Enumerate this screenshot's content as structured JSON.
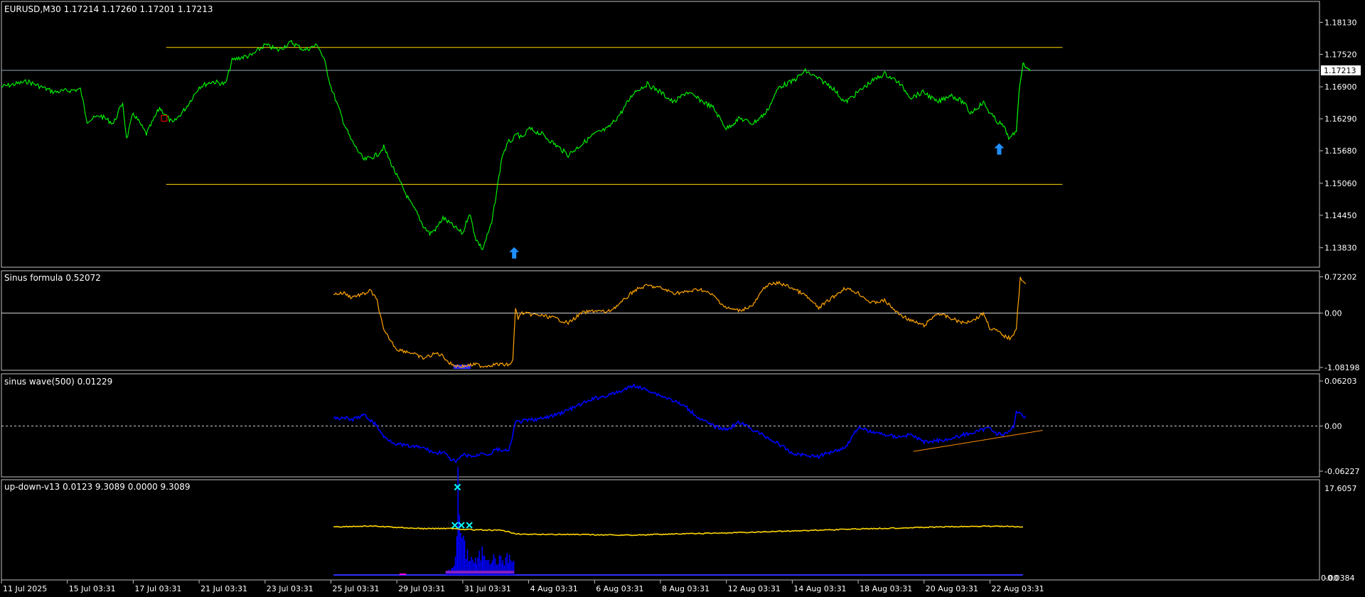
{
  "colors": {
    "background": "#000000",
    "frame": "#c0c0c0",
    "text": "#ffffff",
    "price_line": "#00ff00",
    "channel": "#ffd700",
    "current_price_line": "#8fa3b8",
    "sinus_formula": "#ffa500",
    "sinus_wave": "#0000ff",
    "trendline": "#ff8c00",
    "updown_line": "#ffd700",
    "updown_hist": "#0000ff",
    "arrow": "#1e90ff",
    "cross": "#00ffff"
  },
  "icons": {
    "buy_arrow": "up-arrow-icon",
    "signal_cross": "cross-icon",
    "pending_marker": "square-marker-icon"
  },
  "chart_data": [
    {
      "id": "main",
      "type": "line",
      "title": "EURUSD,M30  1.17214 1.17260 1.17201 1.17213",
      "ylim": [
        1.1354,
        1.1842
      ],
      "yticks": [
        "1.18130",
        "1.17520",
        "1.16900",
        "1.16290",
        "1.15680",
        "1.15060",
        "1.14450",
        "1.13830"
      ],
      "current_price": "1.17213",
      "channel": {
        "upper": 1.1765,
        "lower": 1.1504,
        "x_start": 0.125,
        "x_end": 0.805
      },
      "series": [
        {
          "x": [
            0.0,
            0.02,
            0.04,
            0.06,
            0.065,
            0.075,
            0.085,
            0.092,
            0.095,
            0.1,
            0.11,
            0.12,
            0.13,
            0.14,
            0.15,
            0.16,
            0.17,
            0.175,
            0.18,
            0.19,
            0.2,
            0.21,
            0.22,
            0.23,
            0.24,
            0.245,
            0.25,
            0.26,
            0.265,
            0.275,
            0.285,
            0.29,
            0.3,
            0.31,
            0.315,
            0.32,
            0.325,
            0.33,
            0.335,
            0.345,
            0.35,
            0.355,
            0.36,
            0.365,
            0.372,
            0.38,
            0.385,
            0.388,
            0.39,
            0.392,
            0.395,
            0.4,
            0.41,
            0.42,
            0.43,
            0.44,
            0.45,
            0.46,
            0.47,
            0.48,
            0.49,
            0.5,
            0.51,
            0.52,
            0.53,
            0.54,
            0.55,
            0.56,
            0.57,
            0.58,
            0.59,
            0.6,
            0.61,
            0.62,
            0.63,
            0.64,
            0.65,
            0.66,
            0.67,
            0.68,
            0.69,
            0.7,
            0.71,
            0.72,
            0.73,
            0.735,
            0.74,
            0.745,
            0.75,
            0.755,
            0.76,
            0.765,
            0.77
          ],
          "y": [
            1.169,
            1.17,
            1.168,
            1.1685,
            1.1625,
            1.1635,
            1.162,
            1.166,
            1.159,
            1.164,
            1.16,
            1.165,
            1.162,
            1.165,
            1.169,
            1.17,
            1.1695,
            1.174,
            1.1745,
            1.175,
            1.177,
            1.176,
            1.1775,
            1.176,
            1.177,
            1.174,
            1.169,
            1.162,
            1.159,
            1.155,
            1.156,
            1.1575,
            1.152,
            1.147,
            1.145,
            1.1425,
            1.141,
            1.142,
            1.144,
            1.142,
            1.141,
            1.145,
            1.14,
            1.138,
            1.143,
            1.156,
            1.1585,
            1.159,
            1.1595,
            1.16,
            1.159,
            1.161,
            1.16,
            1.158,
            1.156,
            1.158,
            1.16,
            1.161,
            1.164,
            1.168,
            1.1695,
            1.168,
            1.166,
            1.168,
            1.1665,
            1.165,
            1.161,
            1.163,
            1.162,
            1.164,
            1.169,
            1.17,
            1.172,
            1.1705,
            1.169,
            1.166,
            1.168,
            1.17,
            1.1715,
            1.17,
            1.167,
            1.168,
            1.166,
            1.1675,
            1.166,
            1.164,
            1.165,
            1.166,
            1.164,
            1.1625,
            1.1615,
            1.159,
            1.1605
          ]
        }
      ],
      "tail": {
        "x": [
          0.772,
          0.775,
          0.778,
          0.781
        ],
        "y": [
          1.168,
          1.1735,
          1.1725,
          1.17213
        ]
      },
      "markers": [
        {
          "type": "buy_arrow",
          "x": 0.389,
          "y": 1.1372
        },
        {
          "type": "buy_arrow",
          "x": 0.757,
          "y": 1.157
        },
        {
          "type": "pending_marker",
          "x": 0.1235,
          "y": 1.163
        }
      ]
    },
    {
      "id": "sinus_formula",
      "type": "line",
      "title": "Sinus formula 0.52072",
      "ylim": [
        -1.08198,
        0.8
      ],
      "yticks": [
        "0.72202",
        "0.00",
        "-1.08198"
      ],
      "zero": 0,
      "series": [
        {
          "x": [
            0.252,
            0.26,
            0.265,
            0.275,
            0.28,
            0.285,
            0.29,
            0.3,
            0.31,
            0.32,
            0.33,
            0.335,
            0.34,
            0.345,
            0.35,
            0.36,
            0.365,
            0.37,
            0.375,
            0.385,
            0.388,
            0.39,
            0.392,
            0.395,
            0.4,
            0.41,
            0.42,
            0.43,
            0.44,
            0.45,
            0.46,
            0.47,
            0.48,
            0.49,
            0.5,
            0.51,
            0.52,
            0.53,
            0.54,
            0.55,
            0.56,
            0.57,
            0.58,
            0.59,
            0.6,
            0.61,
            0.62,
            0.63,
            0.64,
            0.65,
            0.66,
            0.67,
            0.68,
            0.69,
            0.7,
            0.71,
            0.72,
            0.73,
            0.74,
            0.745,
            0.75,
            0.755,
            0.76,
            0.765,
            0.768,
            0.77,
            0.773,
            0.775,
            0.777
          ],
          "y": [
            0.38,
            0.4,
            0.32,
            0.38,
            0.45,
            0.25,
            -0.35,
            -0.72,
            -0.78,
            -0.9,
            -0.8,
            -0.85,
            -1.0,
            -1.05,
            -1.06,
            -1.02,
            -1.06,
            -1.04,
            -1.02,
            -1.03,
            -0.95,
            0.1,
            -0.1,
            0.0,
            -0.02,
            -0.05,
            -0.1,
            -0.2,
            0.0,
            0.05,
            0.02,
            0.2,
            0.45,
            0.55,
            0.5,
            0.4,
            0.42,
            0.48,
            0.35,
            0.1,
            0.05,
            0.15,
            0.55,
            0.6,
            0.5,
            0.35,
            0.1,
            0.3,
            0.5,
            0.4,
            0.2,
            0.25,
            0.0,
            -0.15,
            -0.25,
            0.0,
            -0.1,
            -0.2,
            -0.1,
            0.0,
            -0.3,
            -0.35,
            -0.45,
            -0.5,
            -0.4,
            -0.3,
            0.72,
            0.62,
            0.58
          ]
        }
      ],
      "fill_band": {
        "x_start": 0.343,
        "x_end": 0.356,
        "y": -1.07
      }
    },
    {
      "id": "sinus_wave",
      "type": "line",
      "title": "sinus wave(500) 0.01229",
      "ylim": [
        -0.06227,
        0.06203
      ],
      "yticks": [
        "0.06203",
        "0.00",
        "-0.06227"
      ],
      "zero": 0,
      "series": [
        {
          "x": [
            0.252,
            0.26,
            0.265,
            0.275,
            0.28,
            0.285,
            0.29,
            0.3,
            0.31,
            0.32,
            0.33,
            0.335,
            0.34,
            0.345,
            0.35,
            0.36,
            0.365,
            0.37,
            0.375,
            0.385,
            0.39,
            0.4,
            0.41,
            0.42,
            0.43,
            0.44,
            0.45,
            0.46,
            0.47,
            0.48,
            0.485,
            0.49,
            0.5,
            0.51,
            0.52,
            0.53,
            0.54,
            0.55,
            0.56,
            0.57,
            0.58,
            0.59,
            0.6,
            0.61,
            0.62,
            0.63,
            0.64,
            0.65,
            0.66,
            0.67,
            0.68,
            0.69,
            0.7,
            0.71,
            0.72,
            0.73,
            0.74,
            0.745,
            0.75,
            0.755,
            0.76,
            0.765,
            0.768,
            0.77,
            0.773,
            0.775,
            0.777
          ],
          "y": [
            0.01,
            0.012,
            0.008,
            0.015,
            0.008,
            0.0,
            -0.015,
            -0.025,
            -0.028,
            -0.03,
            -0.038,
            -0.035,
            -0.045,
            -0.05,
            -0.04,
            -0.042,
            -0.036,
            -0.04,
            -0.032,
            -0.035,
            0.005,
            0.008,
            0.01,
            0.015,
            0.022,
            0.03,
            0.038,
            0.042,
            0.048,
            0.056,
            0.052,
            0.05,
            0.042,
            0.035,
            0.025,
            0.01,
            0.0,
            -0.005,
            0.005,
            -0.005,
            -0.015,
            -0.025,
            -0.038,
            -0.04,
            -0.042,
            -0.035,
            -0.03,
            -0.002,
            -0.008,
            -0.012,
            -0.015,
            -0.012,
            -0.022,
            -0.02,
            -0.018,
            -0.012,
            -0.008,
            -0.005,
            -0.002,
            -0.01,
            -0.012,
            -0.008,
            0.0,
            0.02,
            0.018,
            0.012,
            0.014
          ]
        }
      ],
      "trendline": {
        "x": [
          0.692,
          0.79
        ],
        "y": [
          -0.035,
          -0.006
        ]
      }
    },
    {
      "id": "up_down_v13",
      "type": "bar",
      "title": "up-down-v13 0.0123 9.3089 0.0000 9.3089",
      "ylim": [
        -0.0384,
        17.6057
      ],
      "yticks": [
        "17.6057",
        "-0.0384"
      ],
      "yticks_overlap": "0.00",
      "line": {
        "x": [
          0.252,
          0.28,
          0.3,
          0.32,
          0.34,
          0.36,
          0.38,
          0.39,
          0.4,
          0.42,
          0.45,
          0.48,
          0.5,
          0.55,
          0.6,
          0.65,
          0.7,
          0.75,
          0.76,
          0.77,
          0.775
        ],
        "y": [
          9.3,
          9.45,
          9.2,
          8.95,
          9.0,
          8.7,
          8.6,
          8.0,
          7.8,
          7.85,
          7.75,
          7.7,
          7.85,
          8.1,
          8.5,
          8.9,
          9.2,
          9.45,
          9.4,
          9.3,
          9.3
        ]
      },
      "hist_x_range": [
        0.337,
        0.389
      ],
      "hist_profile": [
        {
          "x": 0.337,
          "y": 0.6
        },
        {
          "x": 0.342,
          "y": 1.2
        },
        {
          "x": 0.344,
          "y": 4.5
        },
        {
          "x": 0.346,
          "y": 16.0
        },
        {
          "x": 0.348,
          "y": 9.0
        },
        {
          "x": 0.351,
          "y": 5.0
        },
        {
          "x": 0.355,
          "y": 3.5
        },
        {
          "x": 0.36,
          "y": 2.5
        },
        {
          "x": 0.365,
          "y": 4.8
        },
        {
          "x": 0.372,
          "y": 3.2
        },
        {
          "x": 0.38,
          "y": 2.8
        },
        {
          "x": 0.385,
          "y": 3.5
        },
        {
          "x": 0.389,
          "y": 2.0
        }
      ],
      "crosses": [
        {
          "x": 0.346,
          "y": 17.0
        },
        {
          "x": 0.344,
          "y": 9.6
        },
        {
          "x": 0.349,
          "y": 9.6
        },
        {
          "x": 0.355,
          "y": 9.6
        }
      ]
    }
  ],
  "x_axis_labels": [
    {
      "label": "11 Jul 2025",
      "x": 0.0
    },
    {
      "label": "15 Jul 03:31",
      "x": 0.05
    },
    {
      "label": "17 Jul 03:31",
      "x": 0.1
    },
    {
      "label": "21 Jul 03:31",
      "x": 0.15
    },
    {
      "label": "23 Jul 03:31",
      "x": 0.2
    },
    {
      "label": "25 Jul 03:31",
      "x": 0.25
    },
    {
      "label": "29 Jul 03:31",
      "x": 0.3
    },
    {
      "label": "31 Jul 03:31",
      "x": 0.35
    },
    {
      "label": "4 Aug 03:31",
      "x": 0.4
    },
    {
      "label": "6 Aug 03:31",
      "x": 0.45
    },
    {
      "label": "8 Aug 03:31",
      "x": 0.5
    },
    {
      "label": "12 Aug 03:31",
      "x": 0.55
    },
    {
      "label": "14 Aug 03:31",
      "x": 0.6
    },
    {
      "label": "18 Aug 03:31",
      "x": 0.65
    },
    {
      "label": "20 Aug 03:31",
      "x": 0.7
    },
    {
      "label": "22 Aug 03:31",
      "x": 0.75
    }
  ]
}
